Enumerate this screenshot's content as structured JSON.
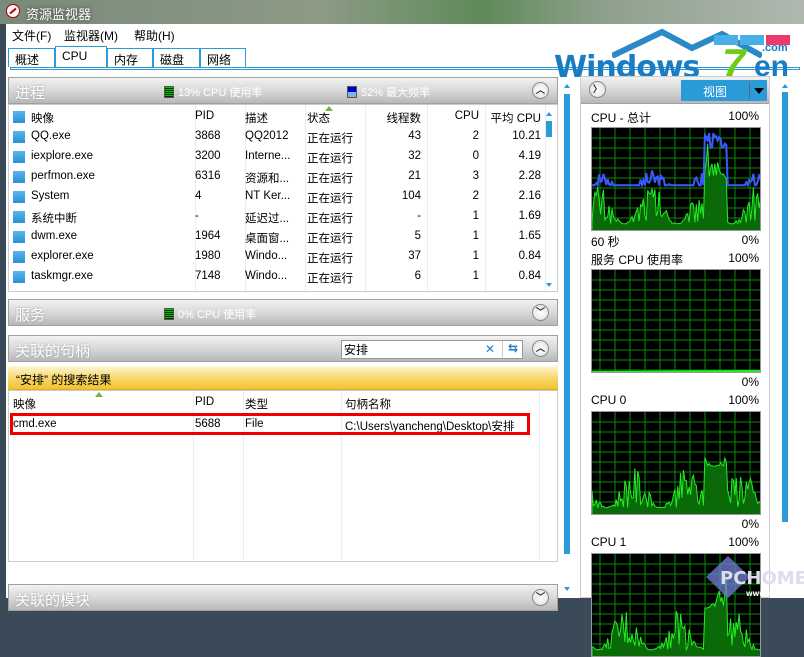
{
  "window": {
    "title": "资源监视器"
  },
  "menu": {
    "items": [
      "文件(F)",
      "监视器(M)",
      "帮助(H)"
    ]
  },
  "tabs": [
    {
      "label": "概述",
      "active": false
    },
    {
      "label": "CPU",
      "active": true
    },
    {
      "label": "内存",
      "active": false
    },
    {
      "label": "磁盘",
      "active": false
    },
    {
      "label": "网络",
      "active": false
    }
  ],
  "logo": {
    "text": "Windows",
    "seven": "7",
    "suffix": "en",
    "domain": ".com",
    "bar_colors": [
      "#4aaee8",
      "#4aaee8",
      "#ee3a6a"
    ]
  },
  "processes": {
    "title": "进程",
    "cpu_usage": "13% CPU 使用率",
    "max_freq": "52% 最大频率",
    "columns": [
      "映像",
      "PID",
      "描述",
      "状态",
      "线程数",
      "CPU",
      "平均 CPU"
    ],
    "rows": [
      {
        "image": "QQ.exe",
        "pid": "3868",
        "desc": "QQ2012",
        "status": "正在运行",
        "threads": "43",
        "cpu": "2",
        "avg": "10.21"
      },
      {
        "image": "iexplore.exe",
        "pid": "3200",
        "desc": "Interne...",
        "status": "正在运行",
        "threads": "32",
        "cpu": "0",
        "avg": "4.19"
      },
      {
        "image": "perfmon.exe",
        "pid": "6316",
        "desc": "资源和...",
        "status": "正在运行",
        "threads": "21",
        "cpu": "3",
        "avg": "2.28"
      },
      {
        "image": "System",
        "pid": "4",
        "desc": "NT Ker...",
        "status": "正在运行",
        "threads": "104",
        "cpu": "2",
        "avg": "2.16"
      },
      {
        "image": "系统中断",
        "pid": "-",
        "desc": "延迟过...",
        "status": "正在运行",
        "threads": "-",
        "cpu": "1",
        "avg": "1.69"
      },
      {
        "image": "dwm.exe",
        "pid": "1964",
        "desc": "桌面窗...",
        "status": "正在运行",
        "threads": "5",
        "cpu": "1",
        "avg": "1.65"
      },
      {
        "image": "explorer.exe",
        "pid": "1980",
        "desc": "Windo...",
        "status": "正在运行",
        "threads": "37",
        "cpu": "1",
        "avg": "0.84"
      },
      {
        "image": "taskmgr.exe",
        "pid": "7148",
        "desc": "Windo...",
        "status": "正在运行",
        "threads": "6",
        "cpu": "1",
        "avg": "0.84"
      }
    ]
  },
  "services": {
    "title": "服务",
    "cpu_usage": "0% CPU 使用率"
  },
  "handles": {
    "title": "关联的句柄",
    "search_value": "安排",
    "result_label": "“安排” 的搜索结果",
    "columns": [
      "映像",
      "PID",
      "类型",
      "句柄名称"
    ],
    "rows": [
      {
        "image": "cmd.exe",
        "pid": "5688",
        "type": "File",
        "name": "C:\\Users\\yancheng\\Desktop\\安排"
      }
    ]
  },
  "modules": {
    "title": "关联的模块"
  },
  "right": {
    "view_label": "视图",
    "graphs": [
      {
        "title": "CPU - 总计",
        "max": "100%",
        "footer_left": "60 秒",
        "min": "0%"
      },
      {
        "title": "服务 CPU 使用率",
        "max": "100%",
        "footer_left": "",
        "min": "0%"
      },
      {
        "title": "CPU 0",
        "max": "100%",
        "footer_left": "",
        "min": "0%"
      },
      {
        "title": "CPU 1",
        "max": "100%",
        "footer_left": "",
        "min": ""
      }
    ]
  },
  "watermark": {
    "text": "PCHOME",
    "sub": "WWW.PCHOME.NET"
  }
}
